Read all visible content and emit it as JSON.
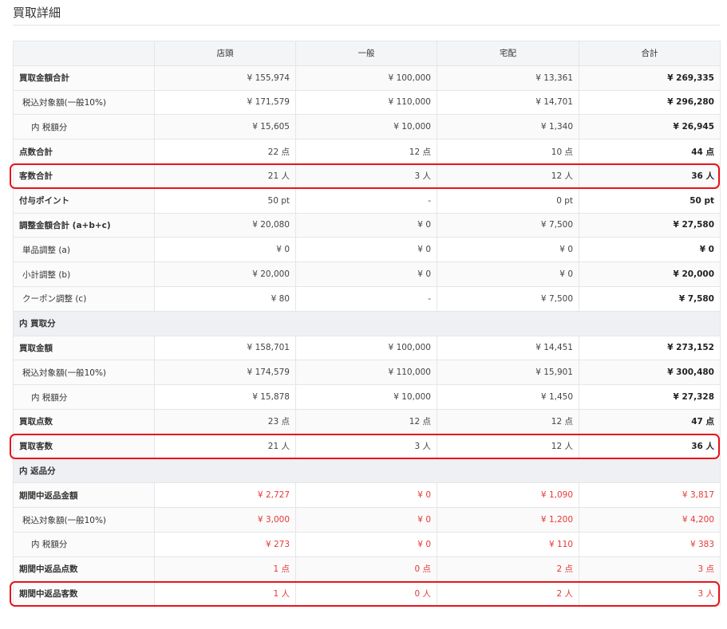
{
  "page": {
    "title": "買取詳細"
  },
  "table": {
    "columns": [
      "店頭",
      "一般",
      "宅配",
      "合計"
    ],
    "rows": [
      {
        "type": "data",
        "style": "bold",
        "label": "買取金額合計",
        "values": [
          "¥ 155,974",
          "¥ 100,000",
          "¥ 13,361",
          "¥ 269,335"
        ]
      },
      {
        "type": "data",
        "style": "indent1",
        "label": "税込対象額(一般10%)",
        "values": [
          "¥ 171,579",
          "¥ 110,000",
          "¥ 14,701",
          "¥ 296,280"
        ]
      },
      {
        "type": "data",
        "style": "indent2",
        "label": "内 税額分",
        "values": [
          "¥ 15,605",
          "¥ 10,000",
          "¥ 1,340",
          "¥ 26,945"
        ]
      },
      {
        "type": "data",
        "style": "bold",
        "label": "点数合計",
        "values": [
          "22 点",
          "12 点",
          "10 点",
          "44 点"
        ]
      },
      {
        "type": "data",
        "style": "bold",
        "label": "客数合計",
        "values": [
          "21 人",
          "3 人",
          "12 人",
          "36 人"
        ],
        "highlight": true
      },
      {
        "type": "data",
        "style": "bold",
        "label": "付与ポイント",
        "values": [
          "50 pt",
          "-",
          "0 pt",
          "50 pt"
        ]
      },
      {
        "type": "data",
        "style": "bold",
        "label": "調整金額合計 (a+b+c)",
        "values": [
          "¥ 20,080",
          "¥ 0",
          "¥ 7,500",
          "¥ 27,580"
        ]
      },
      {
        "type": "data",
        "style": "indent1",
        "label": "単品調整 (a)",
        "values": [
          "¥ 0",
          "¥ 0",
          "¥ 0",
          "¥ 0"
        ]
      },
      {
        "type": "data",
        "style": "indent1",
        "label": "小計調整 (b)",
        "values": [
          "¥ 20,000",
          "¥ 0",
          "¥ 0",
          "¥ 20,000"
        ]
      },
      {
        "type": "data",
        "style": "indent1",
        "label": "クーポン調整 (c)",
        "values": [
          "¥ 80",
          "-",
          "¥ 7,500",
          "¥ 7,580"
        ]
      },
      {
        "type": "section",
        "label": "内 買取分"
      },
      {
        "type": "data",
        "style": "bold",
        "label": "買取金額",
        "values": [
          "¥ 158,701",
          "¥ 100,000",
          "¥ 14,451",
          "¥ 273,152"
        ]
      },
      {
        "type": "data",
        "style": "indent1",
        "label": "税込対象額(一般10%)",
        "values": [
          "¥ 174,579",
          "¥ 110,000",
          "¥ 15,901",
          "¥ 300,480"
        ]
      },
      {
        "type": "data",
        "style": "indent2",
        "label": "内 税額分",
        "values": [
          "¥ 15,878",
          "¥ 10,000",
          "¥ 1,450",
          "¥ 27,328"
        ]
      },
      {
        "type": "data",
        "style": "bold",
        "label": "買取点数",
        "values": [
          "23 点",
          "12 点",
          "12 点",
          "47 点"
        ]
      },
      {
        "type": "data",
        "style": "bold",
        "label": "買取客数",
        "values": [
          "21 人",
          "3 人",
          "12 人",
          "36 人"
        ],
        "highlight": true
      },
      {
        "type": "section",
        "label": "内 返品分"
      },
      {
        "type": "data",
        "style": "bold",
        "red": true,
        "label": "期間中返品金額",
        "values": [
          "¥ 2,727",
          "¥ 0",
          "¥ 1,090",
          "¥ 3,817"
        ]
      },
      {
        "type": "data",
        "style": "indent1",
        "red": true,
        "label": "税込対象額(一般10%)",
        "values": [
          "¥ 3,000",
          "¥ 0",
          "¥ 1,200",
          "¥ 4,200"
        ]
      },
      {
        "type": "data",
        "style": "indent2",
        "red": true,
        "label": "内 税額分",
        "values": [
          "¥ 273",
          "¥ 0",
          "¥ 110",
          "¥ 383"
        ]
      },
      {
        "type": "data",
        "style": "bold",
        "red": true,
        "label": "期間中返品点数",
        "values": [
          "1 点",
          "0 点",
          "2 点",
          "3 点"
        ]
      },
      {
        "type": "data",
        "style": "bold",
        "red": true,
        "label": "期間中返品客数",
        "values": [
          "1 人",
          "0 人",
          "2 人",
          "3 人"
        ],
        "highlight": true
      }
    ]
  },
  "colors": {
    "highlight_border": "#e8141b",
    "negative_text": "#e53935",
    "header_bg": "#f4f5f7",
    "section_bg": "#eef0f3"
  }
}
